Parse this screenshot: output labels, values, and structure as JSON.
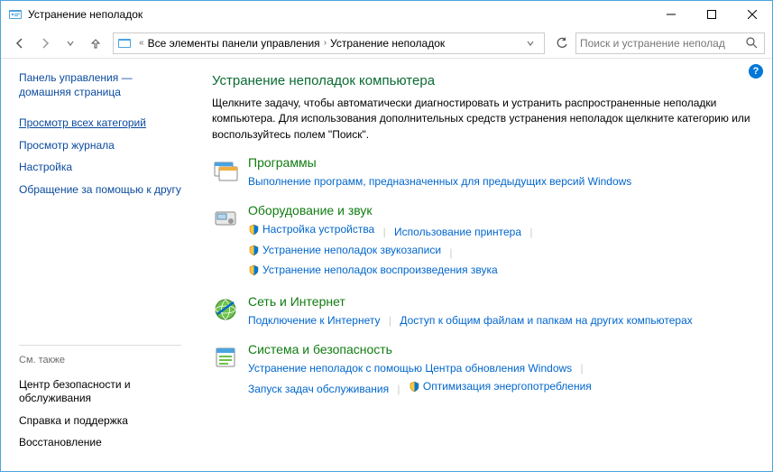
{
  "window": {
    "title": "Устранение неполадок"
  },
  "breadcrumb": {
    "part1": "Все элементы панели управления",
    "part2": "Устранение неполадок"
  },
  "search": {
    "placeholder": "Поиск и устранение неполад"
  },
  "sidebar": {
    "home": "Панель управления — домашняя страница",
    "link_all": "Просмотр всех категорий",
    "link_log": "Просмотр журнала",
    "link_settings": "Настройка",
    "link_help": "Обращение за помощью к другу",
    "see_also": "См. также",
    "see1": "Центр безопасности и обслуживания",
    "see2": "Справка и поддержка",
    "see3": "Восстановление"
  },
  "main": {
    "heading": "Устранение неполадок компьютера",
    "desc": "Щелкните задачу, чтобы автоматически диагностировать и устранить распространенные неполадки компьютера. Для использования дополнительных средств устранения неполадок щелкните категорию или воспользуйтесь полем \"Поиск\".",
    "cats": {
      "c1": {
        "title": "Программы",
        "t1": "Выполнение программ, предназначенных для предыдущих версий Windows"
      },
      "c2": {
        "title": "Оборудование и звук",
        "t1": "Настройка устройства",
        "t2": "Использование принтера",
        "t3": "Устранение неполадок звукозаписи",
        "t4": "Устранение неполадок воспроизведения звука"
      },
      "c3": {
        "title": "Сеть и Интернет",
        "t1": "Подключение к Интернету",
        "t2": "Доступ к общим файлам и папкам на других компьютерах"
      },
      "c4": {
        "title": "Система и безопасность",
        "t1": "Устранение неполадок с помощью Центра обновления Windows",
        "t2": "Запуск задач обслуживания",
        "t3": "Оптимизация энергопотребления"
      }
    }
  }
}
